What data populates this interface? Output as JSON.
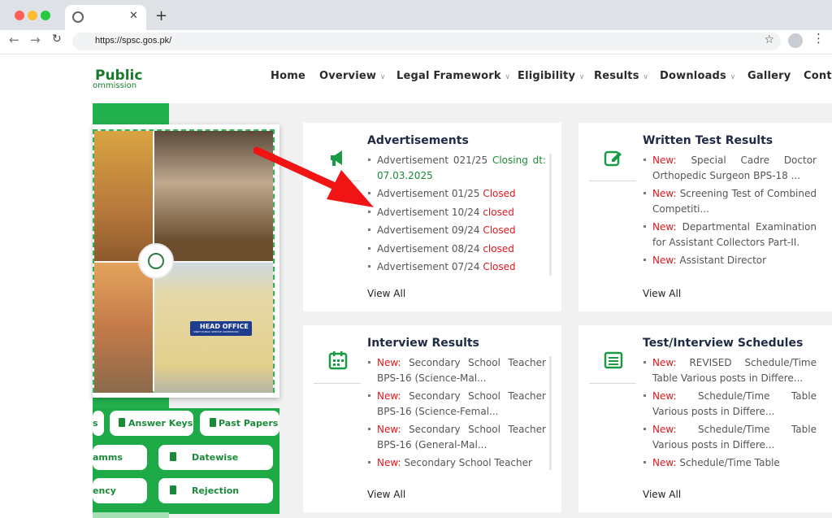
{
  "browser": {
    "url": "https://spsc.gos.pk/",
    "new_tab_symbol": "+",
    "close_symbol": "✕"
  },
  "site": {
    "logo_title": "Public",
    "logo_subtitle": "ommission"
  },
  "nav": [
    {
      "label": "Home",
      "dropdown": false
    },
    {
      "label": "Overview",
      "dropdown": true
    },
    {
      "label": "Legal Framework",
      "dropdown": true
    },
    {
      "label": "Eligibility",
      "dropdown": true
    },
    {
      "label": "Results",
      "dropdown": true
    },
    {
      "label": "Downloads",
      "dropdown": true
    },
    {
      "label": "Gallery",
      "dropdown": false
    },
    {
      "label": "Conta",
      "dropdown": false
    }
  ],
  "quick_links": [
    {
      "label": "s"
    },
    {
      "label": "Answer Keys"
    },
    {
      "label": "Past Papers"
    },
    {
      "label": "amms"
    },
    {
      "label": "Datewise"
    },
    {
      "label": "ency"
    },
    {
      "label": "Rejection"
    }
  ],
  "photo": {
    "sign_text": "HEAD OFFICE",
    "sign_sub": "SINDH PUBLIC SERVICE COMMISSION"
  },
  "cards": {
    "advertisements": {
      "title": "Advertisements",
      "icon": "megaphone-icon",
      "view_all": "View All",
      "items": [
        {
          "text": "Advertisement 021/25",
          "status": "Closing dt: 07.03.2025"
        },
        {
          "text": "Advertisement 01/25",
          "status": "Closed"
        },
        {
          "text": "Advertisement 10/24",
          "status": "closed"
        },
        {
          "text": "Advertisement 09/24",
          "status": "Closed"
        },
        {
          "text": "Advertisement 08/24",
          "status": "closed"
        },
        {
          "text": "Advertisement 07/24",
          "status": "Closed"
        }
      ]
    },
    "written": {
      "title": "Written Test Results",
      "icon": "edit-icon",
      "view_all": "View All",
      "new_label": "New:",
      "items": [
        "Special Cadre Doctor Orthopedic Surgeon BPS-18 ...",
        "Screening Test of Combined Competiti...",
        "Departmental Examination for Assistant Collectors Part-II.",
        "Assistant Director"
      ]
    },
    "interview": {
      "title": "Interview Results",
      "icon": "calendar-icon",
      "view_all": "View All",
      "new_label": "New:",
      "items": [
        "Secondary School Teacher BPS-16 (Science-Mal...",
        "Secondary School Teacher BPS-16 (Science-Femal...",
        "Secondary School Teacher BPS-16 (General-Mal...",
        "Secondary School Teacher"
      ]
    },
    "schedules": {
      "title": "Test/Interview Schedules",
      "icon": "list-icon",
      "view_all": "View All",
      "new_label": "New:",
      "items": [
        "REVISED Schedule/Time Table Various posts in Differe...",
        "Schedule/Time Table Various posts in Differe...",
        "Schedule/Time Table Various posts in Differe...",
        "Schedule/Time Table"
      ]
    }
  },
  "colors": {
    "brand_green": "#23b14d",
    "alert_red": "#e0181e",
    "arrow_red": "#f01414"
  }
}
